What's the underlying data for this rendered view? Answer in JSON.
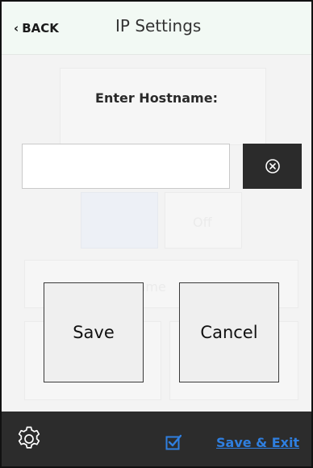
{
  "header": {
    "back_label": "BACK",
    "back_chevron": "‹",
    "title": "IP Settings"
  },
  "background": {
    "faded_text_1": "Off",
    "faded_text_2": "Hostname"
  },
  "dialog": {
    "label": "Enter Hostname:",
    "input_value": "",
    "input_placeholder": "",
    "clear_icon": "clear-circle-icon",
    "save_label": "Save",
    "cancel_label": "Cancel"
  },
  "footer": {
    "settings_icon": "gear-icon",
    "check_icon": "checkbox-icon",
    "save_exit_label": "Save & Exit",
    "accent_color": "#2f7fe0"
  }
}
